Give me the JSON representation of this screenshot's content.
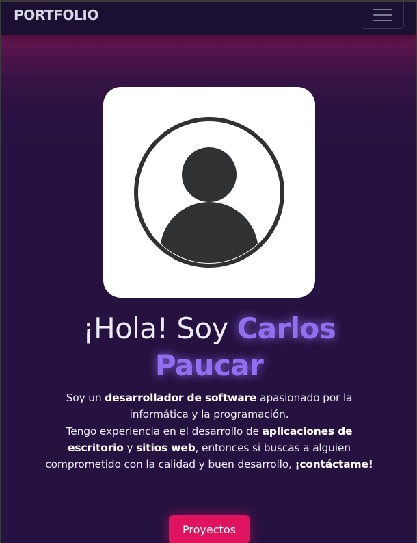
{
  "navbar": {
    "brand": "PORTFOLIO",
    "toggle_icon": "hamburger-menu-icon"
  },
  "hero": {
    "avatar_icon": "user-avatar-icon",
    "greeting": "¡Hola! Soy ",
    "name": "Carlos Paucar",
    "bio": {
      "p1_before": "Soy un ",
      "p1_strong": "desarrollador de software",
      "p1_after": " apasionado por la informática y la programación.",
      "p2_before": "Tengo experiencia en el desarrollo de ",
      "p2_strong1": "aplicaciones de escritorio",
      "p2_mid": " y ",
      "p2_strong2": "sitios web",
      "p2_after": ", entonces si buscas a alguien comprometido con la calidad y buen desarrollo, ",
      "p2_cta": "¡contáctame!"
    },
    "projects_button": "Proyectos"
  },
  "colors": {
    "background": "#251240",
    "navbar": "#1c1032",
    "accent_name": "#9070f1",
    "button": "#e0135f",
    "avatar": "#2f3133"
  }
}
